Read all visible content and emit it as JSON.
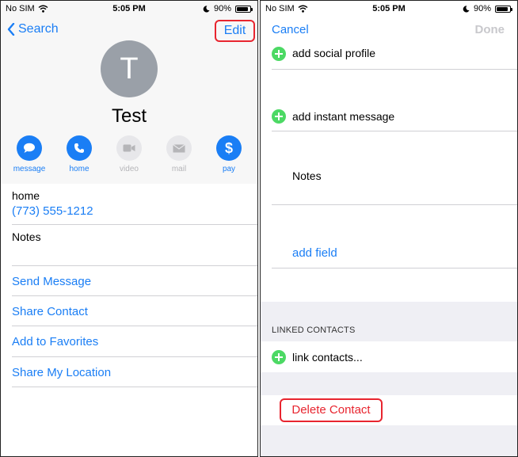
{
  "status_bar": {
    "carrier": "No SIM",
    "time": "5:05 PM",
    "battery": "90%",
    "battery_level": 0.9
  },
  "left": {
    "back_label": "Search",
    "edit_label": "Edit",
    "avatar_initial": "T",
    "contact_name": "Test",
    "actions": [
      {
        "label": "message",
        "icon": "message-icon",
        "enabled": true
      },
      {
        "label": "home",
        "icon": "phone-icon",
        "enabled": true
      },
      {
        "label": "video",
        "icon": "video-icon",
        "enabled": false
      },
      {
        "label": "mail",
        "icon": "mail-icon",
        "enabled": false
      },
      {
        "label": "pay",
        "icon": "dollar-icon",
        "enabled": true
      }
    ],
    "phone_label": "home",
    "phone_number": "(773) 555-1212",
    "notes_label": "Notes",
    "links": [
      "Send Message",
      "Share Contact",
      "Add to Favorites",
      "Share My Location"
    ]
  },
  "right": {
    "cancel_label": "Cancel",
    "done_label": "Done",
    "add_social_profile": "add social profile",
    "add_instant_message": "add instant message",
    "notes_label": "Notes",
    "add_field": "add field",
    "linked_contacts_header": "LINKED CONTACTS",
    "link_contacts": "link contacts...",
    "delete_contact": "Delete Contact"
  },
  "colors": {
    "accent": "#1a7ef5",
    "destructive": "#e8252f",
    "add": "#4cd964",
    "disabled": "#b5b5b8"
  }
}
